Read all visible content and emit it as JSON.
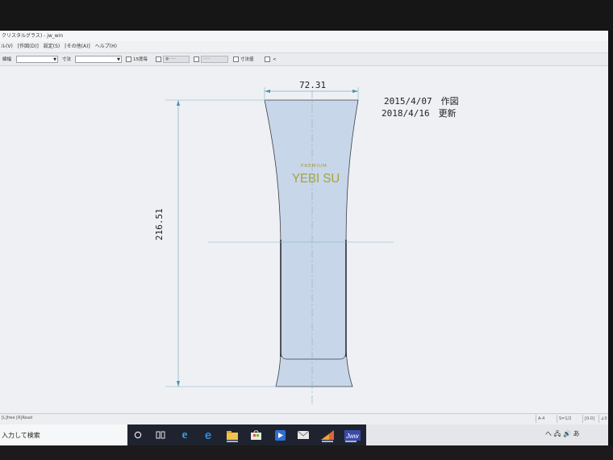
{
  "app": {
    "title": "クリスタルグラス) - jw_win"
  },
  "menu": [
    "ル(V)",
    "[作図(D)]",
    "設定(S)",
    "[その他(A)]",
    "ヘルプ(H)"
  ],
  "toolbar": {
    "field1_label": "線幅",
    "field2_label": "寸法",
    "check1_label": "15度毎",
    "check4_label": "寸法値",
    "check5_label": "<",
    "disabled1_label": "●-----",
    "disabled2_label": "-----"
  },
  "drawing": {
    "width_dimension": "72.31",
    "height_dimension": "216.51",
    "created": "2015/4/07　作図",
    "updated": "2018/4/16　更新",
    "label_small": "PREMIUM",
    "label_big": "YEBI SU",
    "glass_fill": "#c7d6e8",
    "line_color": "#7fb2c9"
  },
  "status": {
    "left": "[L]free [R]Read",
    "cells": [
      "A-4",
      "S=1/2",
      "[0-0]",
      "∠0"
    ]
  },
  "taskbar": {
    "search_text": "入力して検索",
    "tray_text": "へ 🖧 🔊 あ"
  }
}
